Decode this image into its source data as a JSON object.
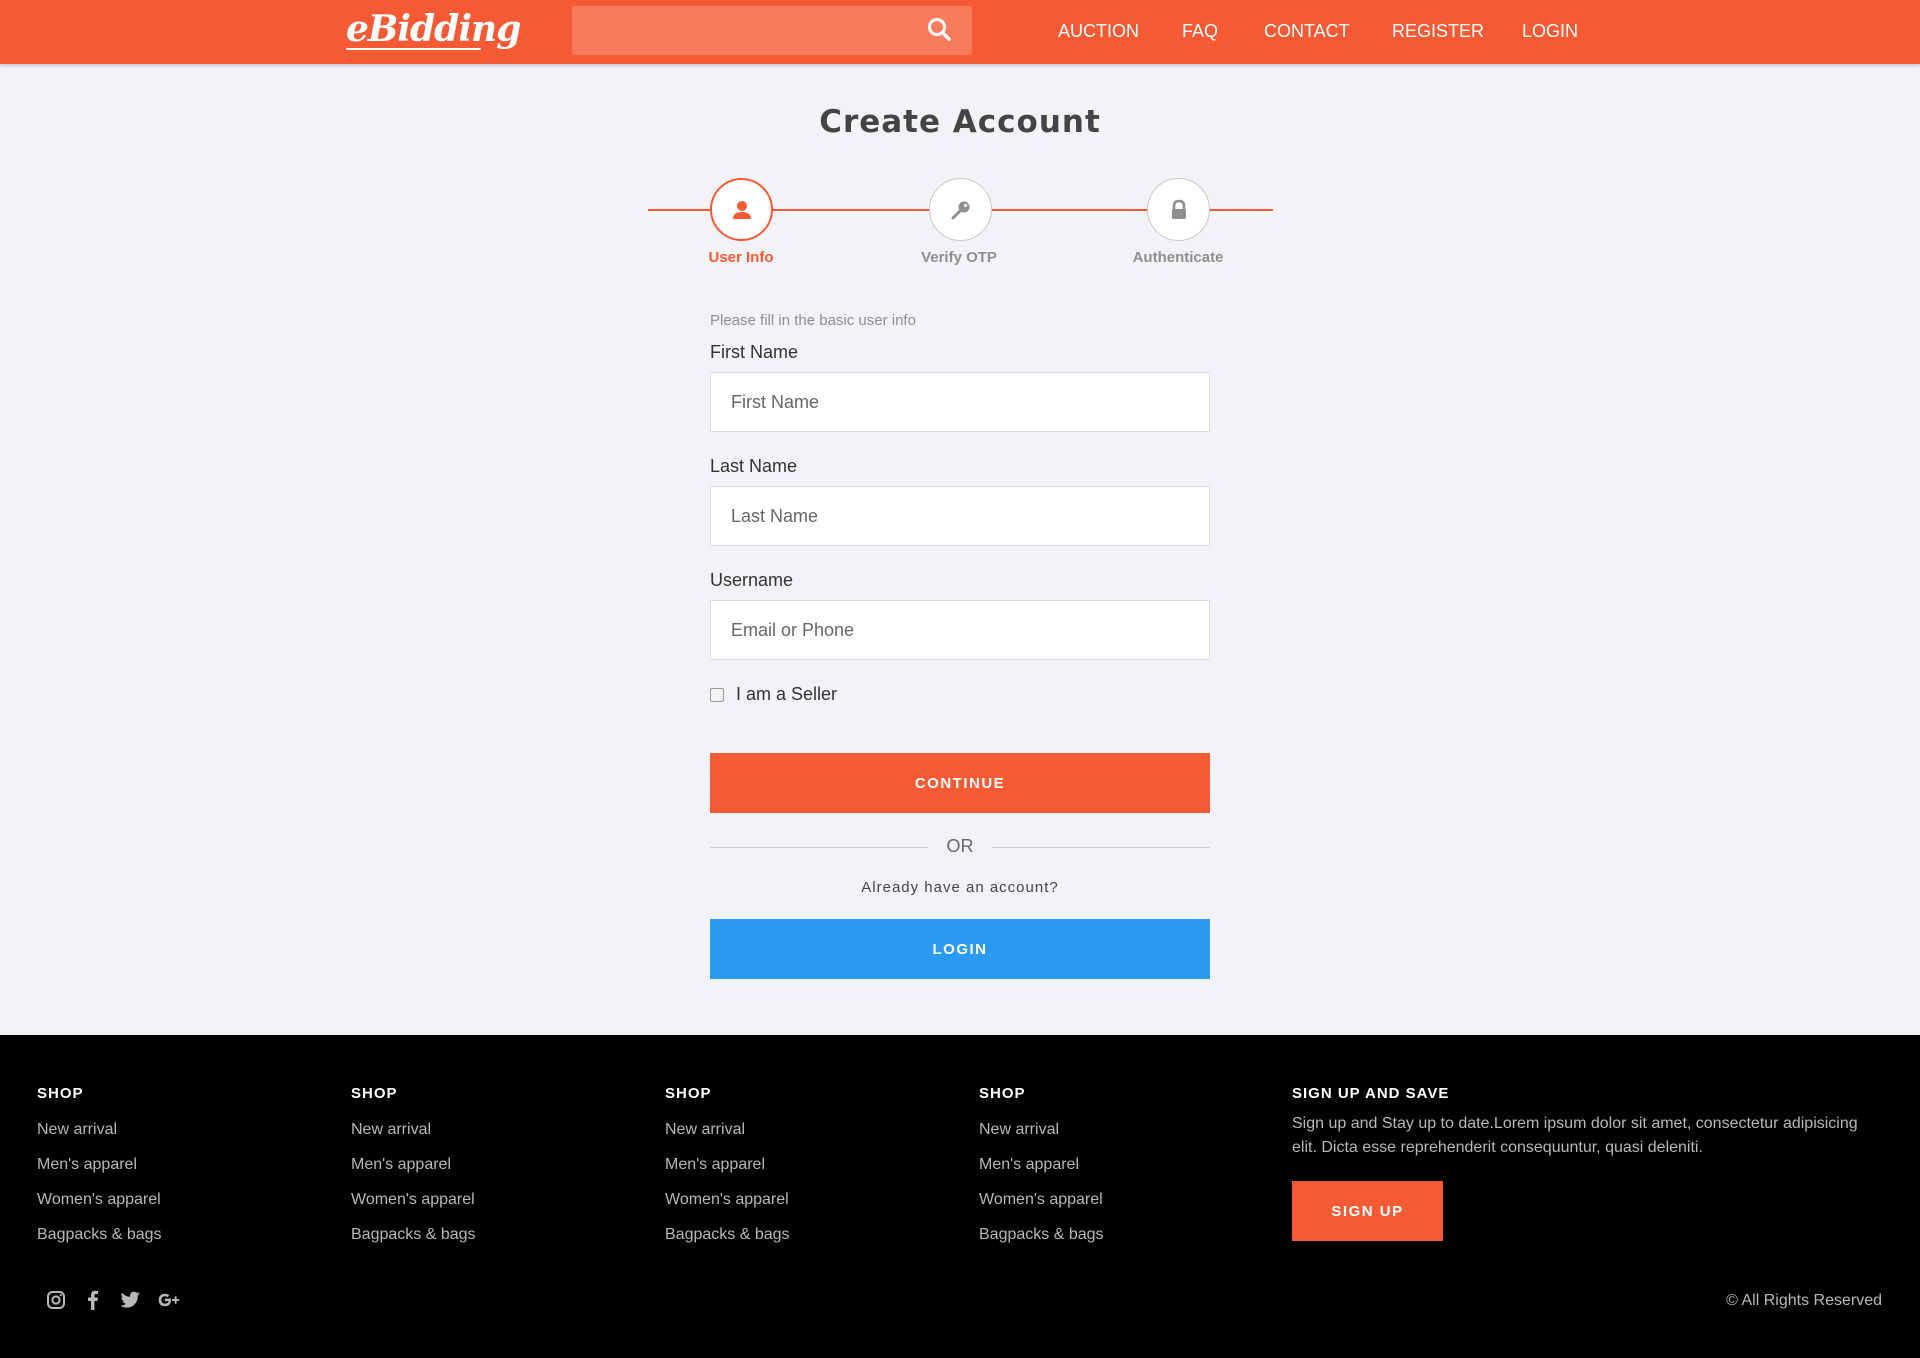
{
  "header": {
    "logo": "eBidding",
    "search_placeholder": "",
    "nav": [
      "AUCTION",
      "FAQ",
      "CONTACT",
      "REGISTER",
      "LOGIN"
    ]
  },
  "main": {
    "title": "Create Account",
    "steps": [
      {
        "label": "User Info",
        "icon": "user-icon",
        "active": true
      },
      {
        "label": "Verify OTP",
        "icon": "key-icon",
        "active": false
      },
      {
        "label": "Authenticate",
        "icon": "lock-icon",
        "active": false
      }
    ],
    "hint": "Please fill in the basic user info",
    "fields": {
      "first_name": {
        "label": "First Name",
        "placeholder": "First Name"
      },
      "last_name": {
        "label": "Last Name",
        "placeholder": "Last Name"
      },
      "username": {
        "label": "Username",
        "placeholder": "Email or Phone"
      }
    },
    "seller_checkbox_label": "I am a Seller",
    "continue_label": "CONTINUE",
    "or_label": "OR",
    "already_text": "Already have an account?",
    "login_label": "LOGIN"
  },
  "footer": {
    "columns": [
      {
        "title": "SHOP",
        "links": [
          "New arrival",
          "Men's apparel",
          "Women's apparel",
          "Bagpacks & bags"
        ]
      },
      {
        "title": "SHOP",
        "links": [
          "New arrival",
          "Men's apparel",
          "Women's apparel",
          "Bagpacks & bags"
        ]
      },
      {
        "title": "SHOP",
        "links": [
          "New arrival",
          "Men's apparel",
          "Women's apparel",
          "Bagpacks & bags"
        ]
      },
      {
        "title": "SHOP",
        "links": [
          "New arrival",
          "Men's apparel",
          "Women's apparel",
          "Bagpacks & bags"
        ]
      }
    ],
    "signup_title": "SIGN UP AND SAVE",
    "signup_desc": "Sign up and Stay up to date.Lorem ipsum dolor sit amet, consectetur adipisicing elit. Dicta esse reprehenderit consequuntur, quasi deleniti.",
    "signup_button": "SIGN UP",
    "social": [
      "instagram-icon",
      "facebook-icon",
      "twitter-icon",
      "google-plus-icon"
    ],
    "copyright": "© All Rights Reserved"
  },
  "colors": {
    "brand": "#f65a34",
    "login_button": "#2b9bf2",
    "footer_bg": "#000000",
    "page_bg": "#f1f3f6"
  }
}
